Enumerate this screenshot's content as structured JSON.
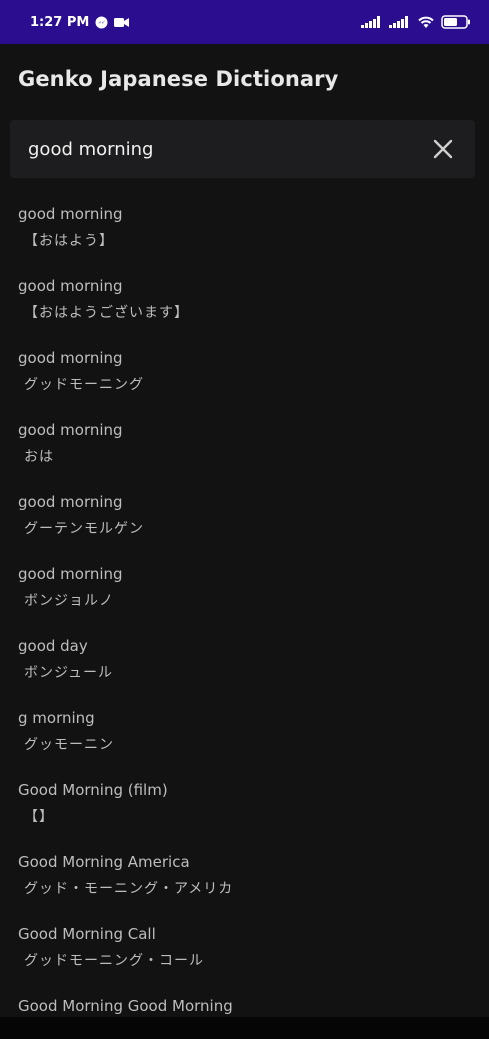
{
  "status_bar": {
    "time": "1:27 PM",
    "battery": "57",
    "bg_color": "#2a0e8f"
  },
  "app_bar": {
    "title": "Genko Japanese Dictionary"
  },
  "search": {
    "value": "good morning",
    "clear_icon": "close-icon"
  },
  "results": [
    {
      "en": "good morning",
      "jp": "【おはよう】"
    },
    {
      "en": "good morning",
      "jp": "【おはようございます】"
    },
    {
      "en": "good morning",
      "jp": "グッドモーニング"
    },
    {
      "en": "good morning",
      "jp": "おは"
    },
    {
      "en": "good morning",
      "jp": "グーテンモルゲン"
    },
    {
      "en": "good morning",
      "jp": "ボンジョルノ"
    },
    {
      "en": "good day",
      "jp": "ボンジュール"
    },
    {
      "en": "g morning",
      "jp": "グッモーニン"
    },
    {
      "en": "Good Morning (film)",
      "jp": "【】"
    },
    {
      "en": "Good Morning America",
      "jp": "グッド・モーニング・アメリカ"
    },
    {
      "en": "Good Morning Call",
      "jp": "グッドモーニング・コール"
    },
    {
      "en": "Good Morning Good Morning",
      "jp": ""
    }
  ]
}
